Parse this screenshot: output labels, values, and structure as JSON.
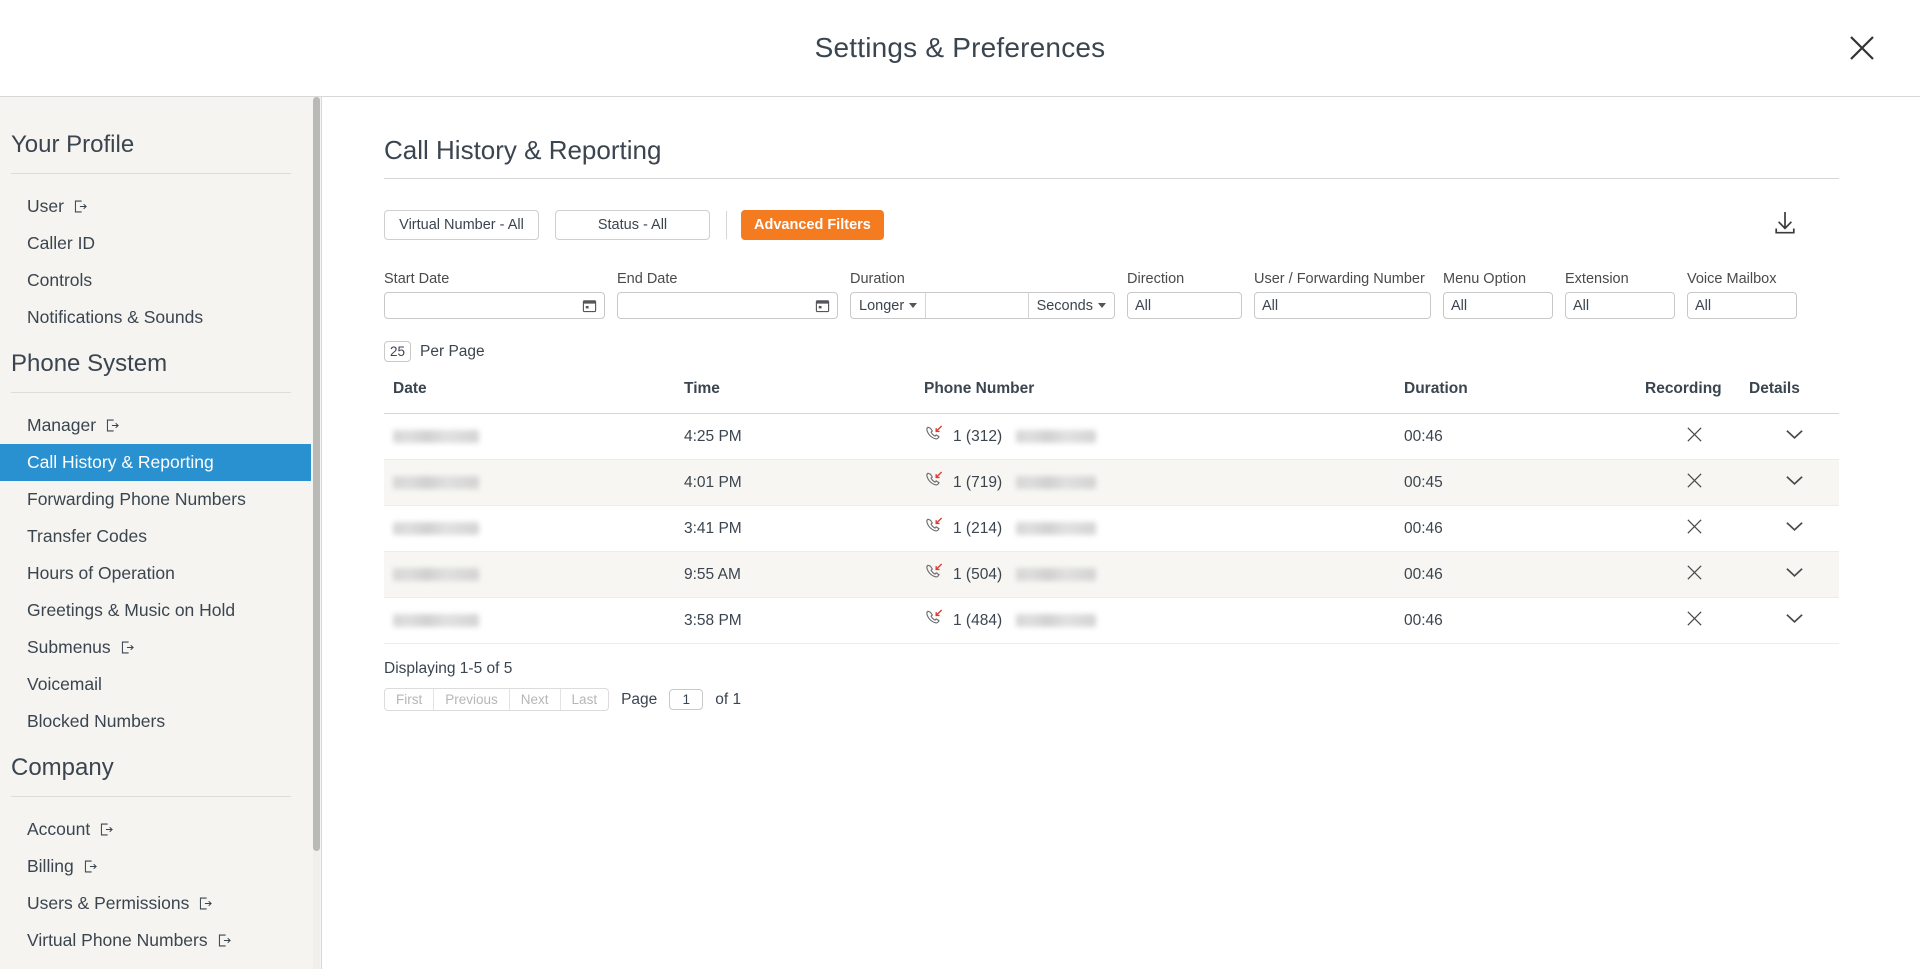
{
  "header": {
    "title": "Settings & Preferences",
    "close_icon": "close-icon"
  },
  "sidebar": {
    "groups": [
      {
        "title": "Your Profile",
        "items": [
          {
            "label": "User",
            "external": true,
            "selected": false
          },
          {
            "label": "Caller ID",
            "external": false,
            "selected": false
          },
          {
            "label": "Controls",
            "external": false,
            "selected": false
          },
          {
            "label": "Notifications & Sounds",
            "external": false,
            "selected": false
          }
        ]
      },
      {
        "title": "Phone System",
        "items": [
          {
            "label": "Manager",
            "external": true,
            "selected": false
          },
          {
            "label": "Call History & Reporting",
            "external": false,
            "selected": true
          },
          {
            "label": "Forwarding Phone Numbers",
            "external": false,
            "selected": false
          },
          {
            "label": "Transfer Codes",
            "external": false,
            "selected": false
          },
          {
            "label": "Hours of Operation",
            "external": false,
            "selected": false
          },
          {
            "label": "Greetings & Music on Hold",
            "external": false,
            "selected": false
          },
          {
            "label": "Submenus",
            "external": true,
            "selected": false
          },
          {
            "label": "Voicemail",
            "external": false,
            "selected": false
          },
          {
            "label": "Blocked Numbers",
            "external": false,
            "selected": false
          }
        ]
      },
      {
        "title": "Company",
        "items": [
          {
            "label": "Account",
            "external": true,
            "selected": false
          },
          {
            "label": "Billing",
            "external": true,
            "selected": false
          },
          {
            "label": "Users & Permissions",
            "external": true,
            "selected": false
          },
          {
            "label": "Virtual Phone Numbers",
            "external": true,
            "selected": false
          }
        ]
      }
    ]
  },
  "main": {
    "page_title": "Call History & Reporting",
    "chips": {
      "virtual_number": "Virtual Number - All",
      "status": "Status - All",
      "advanced_filters": "Advanced Filters",
      "advanced_filters_color": "#f47b20"
    },
    "download_icon": "download-icon",
    "filters": {
      "start_date": {
        "label": "Start Date",
        "value": "",
        "icon": "calendar-icon"
      },
      "end_date": {
        "label": "End Date",
        "value": "",
        "icon": "calendar-icon"
      },
      "duration": {
        "label": "Duration",
        "comparator": "Longer",
        "value": "",
        "unit": "Seconds"
      },
      "direction": {
        "label": "Direction",
        "value": "All"
      },
      "user_forwarding_number": {
        "label": "User / Forwarding Number",
        "value": "All"
      },
      "menu_option": {
        "label": "Menu Option",
        "value": "All"
      },
      "extension": {
        "label": "Extension",
        "value": "All"
      },
      "voice_mailbox": {
        "label": "Voice Mailbox",
        "value": "All"
      }
    },
    "per_page": {
      "value": "25",
      "label": "Per Page"
    },
    "table": {
      "columns": [
        "Date",
        "Time",
        "Phone Number",
        "Duration",
        "Recording",
        "Details"
      ],
      "rows": [
        {
          "date": "",
          "time": "4:25 PM",
          "phone_prefix": "1 (312)",
          "phone_suffix": "",
          "duration": "00:46",
          "call_icon": "missed-call-icon",
          "recording": "no-recording-x-icon",
          "details": "chevron-down-icon"
        },
        {
          "date": "",
          "time": "4:01 PM",
          "phone_prefix": "1 (719)",
          "phone_suffix": "",
          "duration": "00:45",
          "call_icon": "missed-call-icon",
          "recording": "no-recording-x-icon",
          "details": "chevron-down-icon"
        },
        {
          "date": "",
          "time": "3:41 PM",
          "phone_prefix": "1 (214)",
          "phone_suffix": "",
          "duration": "00:46",
          "call_icon": "missed-call-icon",
          "recording": "no-recording-x-icon",
          "details": "chevron-down-icon"
        },
        {
          "date": "",
          "time": "9:55 AM",
          "phone_prefix": "1 (504)",
          "phone_suffix": "",
          "duration": "00:46",
          "call_icon": "missed-call-icon",
          "recording": "no-recording-x-icon",
          "details": "chevron-down-icon"
        },
        {
          "date": "",
          "time": "3:58 PM",
          "phone_prefix": "1 (484)",
          "phone_suffix": "",
          "duration": "00:46",
          "call_icon": "missed-call-icon",
          "recording": "no-recording-x-icon",
          "details": "chevron-down-icon"
        }
      ]
    },
    "pagination": {
      "displaying": "Displaying 1-5 of 5",
      "first": "First",
      "previous": "Previous",
      "next": "Next",
      "last": "Last",
      "page_label": "Page",
      "page_value": "1",
      "of_label": "of 1"
    }
  },
  "colors": {
    "selected_nav": "#2a91d1",
    "accent_orange": "#f47b20",
    "sidebar_bg": "#f5f4f0",
    "text": "#3b4550"
  }
}
